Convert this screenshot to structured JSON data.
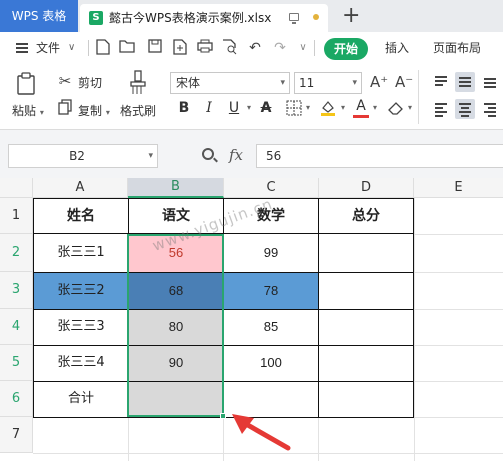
{
  "titlebar": {
    "app_tab": "WPS 表格",
    "doc_tab": "懿古今WPS表格演示案例.xlsx",
    "doc_icon_letter": "S",
    "new_tab_icon": "plus-icon"
  },
  "menu": {
    "file_label": "文件",
    "start_label": "开始",
    "insert_label": "插入",
    "layout_label": "页面布局"
  },
  "ribbon": {
    "paste_label": "粘贴",
    "cut_label": "剪切",
    "copy_label": "复制",
    "format_painter_label": "格式刷",
    "font_name": "宋体",
    "font_size": "11",
    "bold": "B",
    "italic": "I",
    "underline": "U",
    "font_color_letter": "A",
    "grow_font": "A⁺",
    "shrink_font": "A⁻"
  },
  "formula_bar": {
    "name_box": "B2",
    "fx_label": "fx",
    "value": "56"
  },
  "sheet": {
    "col_headers": [
      "A",
      "B",
      "C",
      "D",
      "E"
    ],
    "row_headers": [
      "1",
      "2",
      "3",
      "4",
      "5",
      "6",
      "7"
    ],
    "header_row": [
      "姓名",
      "语文",
      "数学",
      "总分"
    ],
    "rows": [
      {
        "name": "张三三1",
        "chinese": "56",
        "math": "99",
        "total": ""
      },
      {
        "name": "张三三2",
        "chinese": "68",
        "math": "78",
        "total": ""
      },
      {
        "name": "张三三3",
        "chinese": "80",
        "math": "85",
        "total": ""
      },
      {
        "name": "张三三4",
        "chinese": "90",
        "math": "100",
        "total": ""
      },
      {
        "name": "合计",
        "chinese": "",
        "math": "",
        "total": ""
      }
    ],
    "watermark": "www.yigujin.cn"
  },
  "colors": {
    "accent_green": "#1aa864",
    "app_tab_blue": "#3a78d6",
    "low_score_fill": "#ffc7ce",
    "row_highlight_blue": "#5b9bd5",
    "selected_highlight_blue": "#4a7fb5",
    "selection_gray": "#d9d9d9",
    "arrow_red": "#e53935"
  }
}
